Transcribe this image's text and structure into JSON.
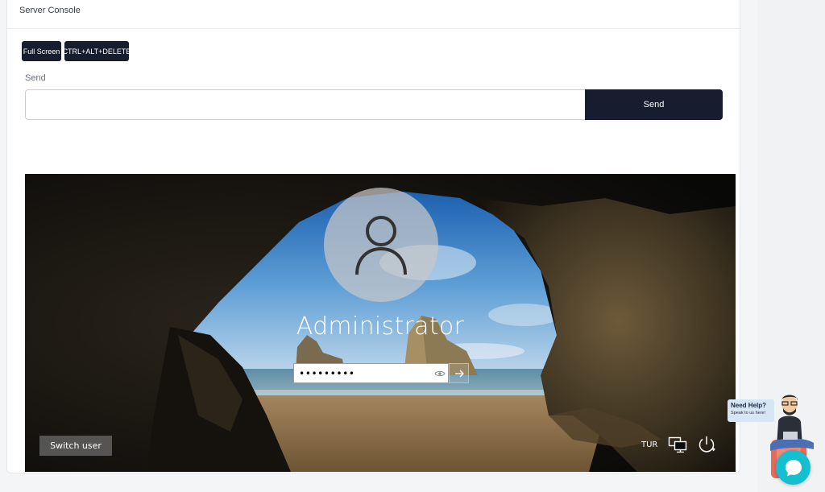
{
  "card": {
    "title": "Server Console"
  },
  "toolbar": {
    "fullscreen_label": "Full Screen",
    "ctrl_alt_delete_label": "CTRL+ALT+DELETE"
  },
  "send": {
    "label": "Send",
    "input_value": "",
    "button_label": "Send"
  },
  "lock_screen": {
    "username": "Administrator",
    "password_value": "•••••••••",
    "switch_user_label": "Switch user",
    "language": "TUR"
  },
  "help_widget": {
    "title": "Need Help?",
    "subtitle": "Speak to us here!"
  },
  "colors": {
    "dark_button": "#171c2e",
    "chat_accent": "#16bfd0"
  }
}
